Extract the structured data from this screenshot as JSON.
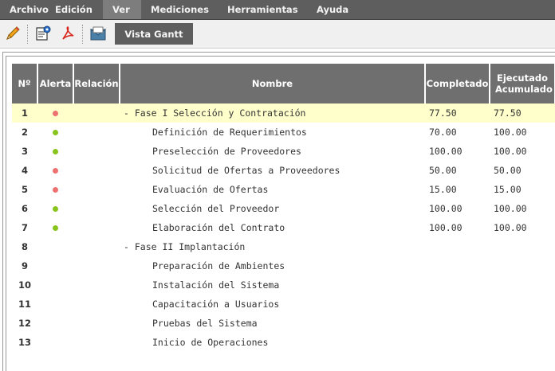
{
  "menu": [
    {
      "label": "Archivo",
      "active": false
    },
    {
      "label": "Edición",
      "active": false
    },
    {
      "label": "Ver",
      "active": true
    },
    {
      "label": "Mediciones",
      "active": false
    },
    {
      "label": "Herramientas",
      "active": false
    },
    {
      "label": "Ayuda",
      "active": false
    }
  ],
  "toolbar": {
    "icons": [
      "pencil-icon",
      "document-gear-icon",
      "pdf-icon",
      "mail-icon"
    ],
    "gantt_label": "Vista Gantt"
  },
  "colors": {
    "alert_red": "#ee7171",
    "alert_green": "#88c41c",
    "highlight": "#ffffcc",
    "header": "#6f6f6f"
  },
  "table": {
    "headers": [
      "Nº",
      "Alerta",
      "Relación",
      "Nombre",
      "Completado",
      "Ejecutado Acumulado"
    ],
    "rows": [
      {
        "num": "1",
        "alert": "red",
        "rel": "",
        "name": "-  Fase I Selección y Contratación",
        "indent": 0,
        "completado": "77.50",
        "ejecutado": "77.50",
        "highlight": true
      },
      {
        "num": "2",
        "alert": "green",
        "rel": "",
        "name": "Definición de Requerimientos",
        "indent": 1,
        "completado": "70.00",
        "ejecutado": "100.00",
        "highlight": false
      },
      {
        "num": "3",
        "alert": "green",
        "rel": "",
        "name": "Preselección de Proveedores",
        "indent": 1,
        "completado": "100.00",
        "ejecutado": "100.00",
        "highlight": false
      },
      {
        "num": "4",
        "alert": "red",
        "rel": "",
        "name": "Solicitud de Ofertas a Proveedores",
        "indent": 1,
        "completado": "50.00",
        "ejecutado": "50.00",
        "highlight": false
      },
      {
        "num": "5",
        "alert": "red",
        "rel": "",
        "name": "Evaluación de Ofertas",
        "indent": 1,
        "completado": "15.00",
        "ejecutado": "15.00",
        "highlight": false
      },
      {
        "num": "6",
        "alert": "green",
        "rel": "",
        "name": "Selección del Proveedor",
        "indent": 1,
        "completado": "100.00",
        "ejecutado": "100.00",
        "highlight": false
      },
      {
        "num": "7",
        "alert": "green",
        "rel": "",
        "name": "Elaboración del Contrato",
        "indent": 1,
        "completado": "100.00",
        "ejecutado": "100.00",
        "highlight": false
      },
      {
        "num": "8",
        "alert": "",
        "rel": "",
        "name": "-  Fase II Implantación",
        "indent": 0,
        "completado": "",
        "ejecutado": "",
        "highlight": false
      },
      {
        "num": "9",
        "alert": "",
        "rel": "",
        "name": "Preparación de Ambientes",
        "indent": 1,
        "completado": "",
        "ejecutado": "",
        "highlight": false
      },
      {
        "num": "10",
        "alert": "",
        "rel": "",
        "name": "Instalación del Sistema",
        "indent": 1,
        "completado": "",
        "ejecutado": "",
        "highlight": false
      },
      {
        "num": "11",
        "alert": "",
        "rel": "",
        "name": "Capacitación a Usuarios",
        "indent": 1,
        "completado": "",
        "ejecutado": "",
        "highlight": false
      },
      {
        "num": "12",
        "alert": "",
        "rel": "",
        "name": "Pruebas del Sistema",
        "indent": 1,
        "completado": "",
        "ejecutado": "",
        "highlight": false
      },
      {
        "num": "13",
        "alert": "",
        "rel": "",
        "name": "Inicio de Operaciones",
        "indent": 1,
        "completado": "",
        "ejecutado": "",
        "highlight": false
      }
    ]
  }
}
